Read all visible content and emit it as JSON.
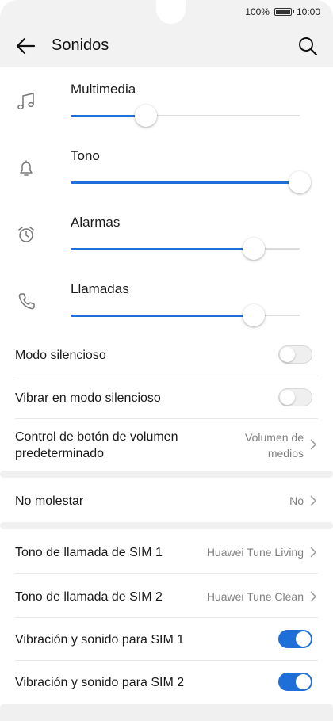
{
  "status": {
    "battery": "100%",
    "time": "10:00",
    "battery_level": 1.0
  },
  "header": {
    "title": "Sonidos"
  },
  "sliders": [
    {
      "label": "Multimedia",
      "icon": "music-note-icon",
      "level": 0.33
    },
    {
      "label": "Tono",
      "icon": "bell-icon",
      "level": 1.0
    },
    {
      "label": "Alarmas",
      "icon": "alarm-clock-icon",
      "level": 0.8
    },
    {
      "label": "Llamadas",
      "icon": "phone-icon",
      "level": 0.8
    }
  ],
  "settings": {
    "silent_mode": {
      "label": "Modo silencioso",
      "on": false
    },
    "vibrate_silent": {
      "label": "Vibrar en modo silencioso",
      "on": false
    },
    "volume_button": {
      "label_line1": "Control de botón de volumen",
      "label_line2": "predeterminado",
      "value_line1": "Volumen de",
      "value_line2": "medios"
    },
    "do_not_disturb": {
      "label": "No molestar",
      "value": "No"
    },
    "sim1_ringtone": {
      "label": "Tono de llamada de SIM 1",
      "value": "Huawei Tune Living"
    },
    "sim2_ringtone": {
      "label": "Tono de llamada de SIM 2",
      "value": "Huawei Tune Clean"
    },
    "sim1_vibration": {
      "label": "Vibración y sonido para SIM 1",
      "on": true
    },
    "sim2_vibration": {
      "label": "Vibración y sonido para SIM 2",
      "on": true
    }
  },
  "colors": {
    "accent": "#1f6fd8",
    "header_bg": "#f2f2f2",
    "secondary_text": "#808080"
  }
}
